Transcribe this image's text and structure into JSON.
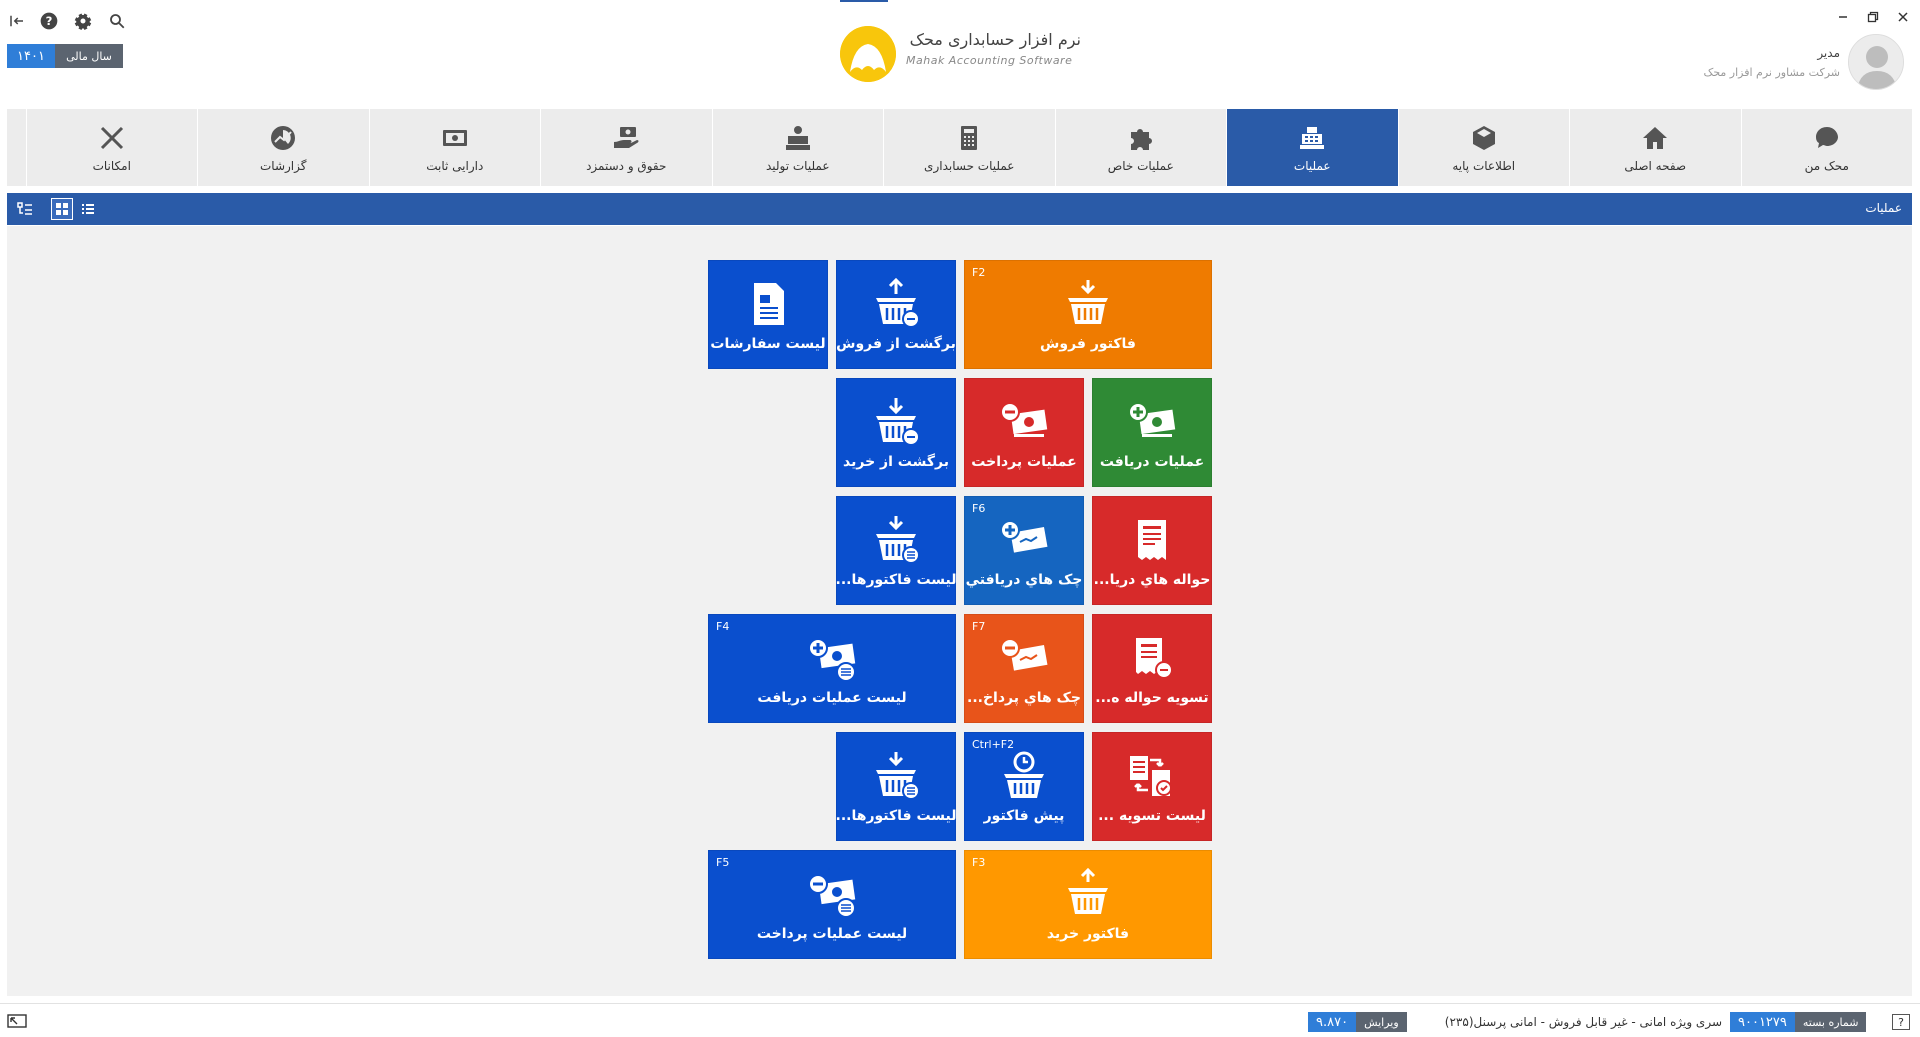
{
  "header": {
    "fiscal_year_label": "سال مالی",
    "fiscal_year_value": "۱۴۰۱",
    "logo_title": "نرم افزار حسابداری محک",
    "logo_subtitle": "Mahak Accounting Software",
    "user_name": "مدیر",
    "user_company": "شرکت مشاور نرم افزار محک"
  },
  "nav": {
    "items": [
      {
        "label": "محک من",
        "icon": "chat-bubble-icon"
      },
      {
        "label": "صفحه اصلی",
        "icon": "home-icon"
      },
      {
        "label": "اطلاعات پایه",
        "icon": "box-icon"
      },
      {
        "label": "عملیات",
        "icon": "cash-register-icon",
        "active": true
      },
      {
        "label": "عملیات خاص",
        "icon": "puzzle-icon"
      },
      {
        "label": "عملیات حسابداری",
        "icon": "calculator-icon"
      },
      {
        "label": "عملیات تولید",
        "icon": "factory-icon"
      },
      {
        "label": "حقوق و دستمزد",
        "icon": "hand-money-icon"
      },
      {
        "label": "دارایی ثابت",
        "icon": "safe-icon"
      },
      {
        "label": "گزارشات",
        "icon": "chart-icon"
      },
      {
        "label": "امکانات",
        "icon": "tools-icon"
      }
    ]
  },
  "section": {
    "title": "عملیات"
  },
  "tiles": {
    "t1": {
      "label": "لیست سفارشات",
      "key": ""
    },
    "t2": {
      "label": "برگشت از فروش",
      "key": ""
    },
    "t3": {
      "label": "فاکتور فروش",
      "key": "F2"
    },
    "t4": {
      "label": "برگشت از خرید",
      "key": ""
    },
    "t5": {
      "label": "عملیات پرداخت",
      "key": ""
    },
    "t6": {
      "label": "عملیات دریافت",
      "key": ""
    },
    "t7": {
      "label": "لیست فاکتورها...",
      "key": ""
    },
    "t8": {
      "label": "چک هاي دريافتي",
      "key": "F6"
    },
    "t9": {
      "label": "حواله هاي دريا...",
      "key": ""
    },
    "t10": {
      "label": "لیست عملیات دریافت",
      "key": "F4"
    },
    "t11": {
      "label": "چک هاي پرداخ...",
      "key": "F7"
    },
    "t12": {
      "label": "تسویه حواله ه...",
      "key": ""
    },
    "t13": {
      "label": "لیست فاکتورها...",
      "key": ""
    },
    "t14": {
      "label": "پیش فاکتور",
      "key": "Ctrl+F2"
    },
    "t15": {
      "label": "لیست تسویه ...",
      "key": ""
    },
    "t16": {
      "label": "لیست عملیات پرداخت",
      "key": "F5"
    },
    "t17": {
      "label": "فاکتور خرید",
      "key": "F3"
    }
  },
  "status": {
    "package_label": "شماره بسته",
    "package_value": "۹۰۰۱۲۷۹",
    "series_text": "سری ویژه امانی - غیر قابل فروش - امانی پرسنل(۲۳۵)",
    "version_label": "ویرایش",
    "version_value": "۹.۸۷۰",
    "help_label": "?"
  },
  "colors": {
    "primary": "#2a5ba8",
    "tile_blue": "#0a4fce",
    "tile_orange": "#ef7b00",
    "tile_red": "#d72a2a",
    "tile_green": "#2f8a35"
  }
}
